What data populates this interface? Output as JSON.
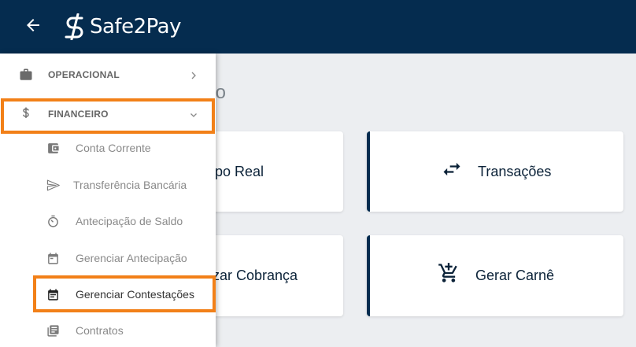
{
  "header": {
    "brand": "Safe2Pay",
    "back_icon": "arrow-left-icon",
    "logo_icon": "safe2pay-logo-icon",
    "background": "#052c4f"
  },
  "main": {
    "heading": "ido",
    "cards": [
      {
        "label": "mpo Real",
        "icon": ""
      },
      {
        "label": "Transações",
        "icon": "swap-arrows-icon"
      },
      {
        "label": "zar Cobrança",
        "icon": ""
      },
      {
        "label": "Gerar Carnê",
        "icon": "add-cart-icon"
      }
    ]
  },
  "sidebar": {
    "groups": [
      {
        "label": "OPERACIONAL",
        "icon": "briefcase-icon",
        "chevron": "chevron-right-icon"
      },
      {
        "label": "FINANCEIRO",
        "icon": "dollar-icon",
        "chevron": "chevron-down-icon"
      }
    ],
    "items": [
      {
        "label": "Conta Corrente",
        "icon": "wallet-icon"
      },
      {
        "label": "Transferência Bancária",
        "icon": "send-icon"
      },
      {
        "label": "Antecipação de Saldo",
        "icon": "timer-icon"
      },
      {
        "label": "Gerenciar Antecipação",
        "icon": "calendar-icon"
      },
      {
        "label": "Gerenciar Contestações",
        "icon": "calendar-list-icon"
      },
      {
        "label": "Contratos",
        "icon": "document-list-icon"
      }
    ]
  },
  "colors": {
    "highlight": "#f28018",
    "accent": "#052c4f",
    "background": "#eceef1"
  }
}
